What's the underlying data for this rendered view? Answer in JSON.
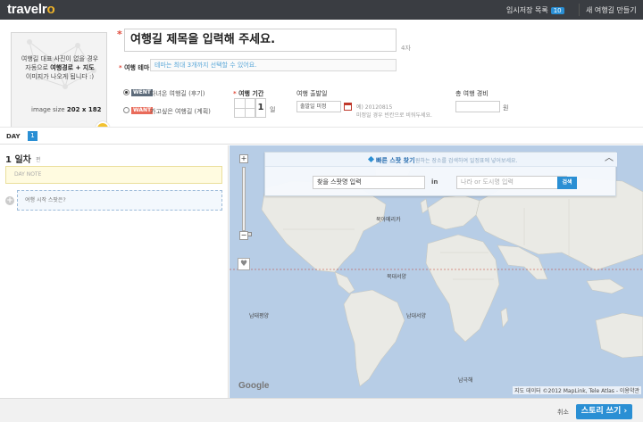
{
  "topbar": {
    "logo": "travelro",
    "temp_saved_label": "임시저장 목록",
    "temp_saved_count": "10",
    "new_story_label": "새 여행길 만들기"
  },
  "cover": {
    "line1": "여행길 대표 사진이 없을 경우",
    "line2_pre": "자동으로 ",
    "line2_bold": "여행경로 + 지도",
    "line3": "이미지가 나오게 됩니다 :)",
    "size_label": "image size",
    "size_value": "202 x 182"
  },
  "form": {
    "title_value": "여행길 제목을 입력해 주세요.",
    "title_counter": "4자",
    "theme_label": "여행 테마",
    "theme_placeholder": "테마는 최대 3개까지 선택할 수 있어요.",
    "went_tag": "WENT",
    "went_text": "다녀온 여행길 (후기)",
    "want_tag": "WANT",
    "want_text": "가고싶은 여행길 (계획)",
    "duration_label": "여행 기간",
    "duration_value": "1",
    "duration_unit": "일",
    "departure_label": "여행 출발일",
    "departure_value": "출발일 미정",
    "departure_hint1": "예) 20120815",
    "departure_hint2": "미정일 경우 빈칸으로 비워두세요.",
    "cost_label": "총 여행 경비",
    "cost_unit": "원"
  },
  "daybar": {
    "label": "DAY",
    "tab": "1"
  },
  "left": {
    "day_title": "1 일차",
    "day_edit": "편",
    "day_note": "DAY NOTE",
    "add_place": "여행 시작 스팟은?"
  },
  "spot": {
    "title": "빠른 스팟 찾기",
    "subtitle": "원하는 장소를 검색하여 일정표에 넣어보세요.",
    "place_value": "찾을 스팟명 입력",
    "in_label": "in",
    "city_placeholder": "나라 or 도시명 입력",
    "search_btn": "검색"
  },
  "map": {
    "google": "Google",
    "attribution": "지도 데이터 ©2012 MapLink, Tele Atlas - 이용약관",
    "labels": [
      {
        "name": "북대서양",
        "kind": "ocean"
      },
      {
        "name": "남태평양",
        "kind": "ocean"
      },
      {
        "name": "남대서양",
        "kind": "ocean"
      },
      {
        "name": "남극해",
        "kind": "ocean"
      },
      {
        "name": "북아메리카",
        "kind": "continent"
      }
    ]
  },
  "footer": {
    "cancel": "취소",
    "story_button": "스토리 쓰기"
  },
  "colors": {
    "accent": "#2a8fd4",
    "topbar": "#3a3d42",
    "required": "#e04b3c",
    "ocean": "#b7cde6",
    "land": "#eaeae5"
  }
}
